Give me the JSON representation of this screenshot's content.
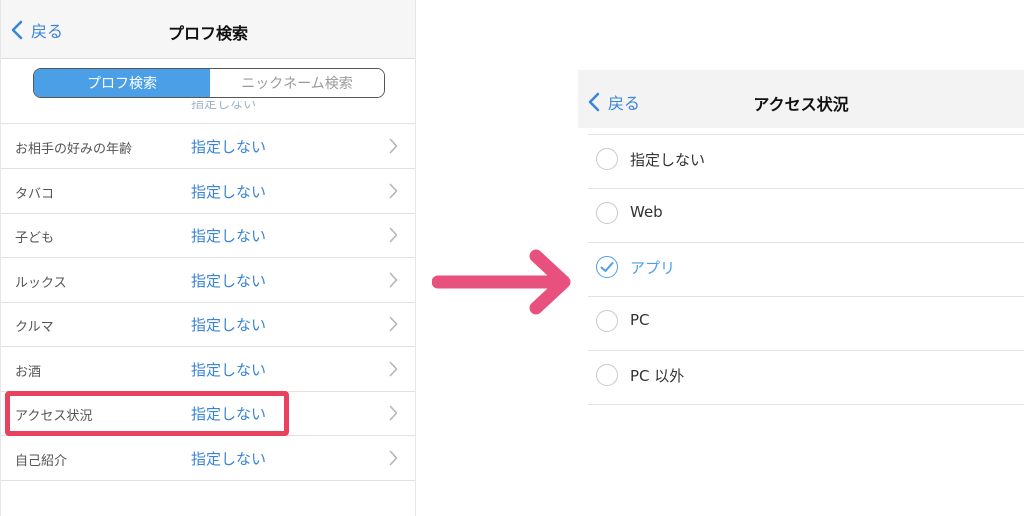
{
  "left_screen": {
    "back_label": "戻る",
    "title": "プロフ検索",
    "segments": [
      "プロフ検索",
      "ニックネーム検索"
    ],
    "cutoff_value": "指定しない",
    "rows": [
      {
        "label": "お相手の好みの年齢",
        "value": "指定しない"
      },
      {
        "label": "タバコ",
        "value": "指定しない"
      },
      {
        "label": "子ども",
        "value": "指定しない"
      },
      {
        "label": "ルックス",
        "value": "指定しない"
      },
      {
        "label": "クルマ",
        "value": "指定しない"
      },
      {
        "label": "お酒",
        "value": "指定しない"
      },
      {
        "label": "アクセス状況",
        "value": "指定しない"
      },
      {
        "label": "自己紹介",
        "value": "指定しない"
      }
    ]
  },
  "right_screen": {
    "back_label": "戻る",
    "title": "アクセス状況",
    "options": [
      {
        "label": "指定しない",
        "selected": false
      },
      {
        "label": "Web",
        "selected": false
      },
      {
        "label": "アプリ",
        "selected": true
      },
      {
        "label": "PC",
        "selected": false
      },
      {
        "label": "PC 以外",
        "selected": false
      }
    ]
  },
  "colors": {
    "accent": "#3a84d8",
    "segment_active": "#4a9fe6",
    "highlight": "#e8425e",
    "arrow": "#e8517e"
  },
  "icons": {
    "back": "chevron-left-icon",
    "row": "chevron-right-icon",
    "radio_checked": "check-icon"
  }
}
